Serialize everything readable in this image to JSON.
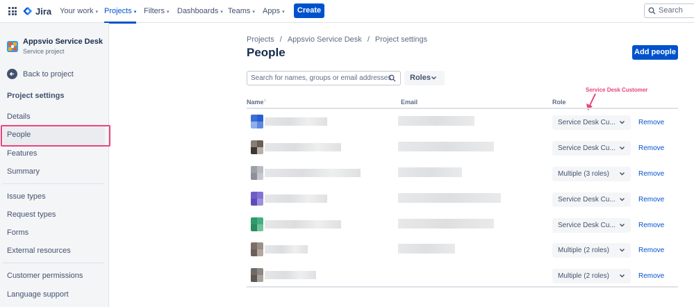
{
  "nav": {
    "logo_text": "Jira",
    "items": [
      {
        "label": "Your work",
        "active": false
      },
      {
        "label": "Projects",
        "active": true
      },
      {
        "label": "Filters",
        "active": false
      },
      {
        "label": "Dashboards",
        "active": false
      },
      {
        "label": "Teams",
        "active": false
      },
      {
        "label": "Apps",
        "active": false
      }
    ],
    "create_label": "Create",
    "search_placeholder": "Search"
  },
  "sidebar": {
    "project_name": "Appsvio Service Desk",
    "project_type": "Service project",
    "back_label": "Back to project",
    "heading": "Project settings",
    "items": [
      {
        "label": "Details"
      },
      {
        "label": "People"
      },
      {
        "label": "Features"
      },
      {
        "label": "Summary"
      },
      {
        "label": "Issue types"
      },
      {
        "label": "Request types"
      },
      {
        "label": "Forms"
      },
      {
        "label": "External resources"
      },
      {
        "label": "Customer permissions"
      },
      {
        "label": "Language support"
      }
    ]
  },
  "main": {
    "breadcrumb": [
      "Projects",
      "/",
      "Appsvio Service Desk",
      "/",
      "Project settings"
    ],
    "title": "People",
    "add_label": "Add people",
    "filter_placeholder": "Search for names, groups or email addresses",
    "roles_label": "Roles",
    "annotation": "Service Desk Customer",
    "columns": {
      "name": "Name",
      "sort_indicator": "↑",
      "email": "Email",
      "role": "Role"
    },
    "rows": [
      {
        "role": "Service Desk Cu...",
        "remove": "Remove",
        "avatar": [
          "#3a6fd8",
          "#2b5fd1",
          "#8fb0ea",
          "#5f89df"
        ]
      },
      {
        "role": "Service Desk Cu...",
        "remove": "Remove",
        "avatar": [
          "#8a7d72",
          "#6b5e55",
          "#3b3733",
          "#b8aea4"
        ]
      },
      {
        "role": "Multiple (3 roles)",
        "remove": "Remove",
        "avatar": [
          "#9ea0a8",
          "#b9bbc2",
          "#8e9098",
          "#c8c9ce"
        ]
      },
      {
        "role": "Service Desk Cu...",
        "remove": "Remove",
        "avatar": [
          "#6e5ec8",
          "#8273d4",
          "#5b4cb8",
          "#9c90de"
        ]
      },
      {
        "role": "Service Desk Cu...",
        "remove": "Remove",
        "avatar": [
          "#2e9a6b",
          "#45b07f",
          "#2a8a60",
          "#6fc39b"
        ]
      },
      {
        "role": "Multiple (2 roles)",
        "remove": "Remove",
        "avatar": [
          "#7d6f66",
          "#9c8f86",
          "#6b5f57",
          "#b3a79f"
        ]
      },
      {
        "role": "Multiple (2 roles)",
        "remove": "Remove",
        "avatar": [
          "#6f6a66",
          "#8e8883",
          "#5c5854",
          "#a9a39e"
        ]
      }
    ]
  },
  "colors": {
    "accent": "#0052cc",
    "annotation": "#e8447a"
  }
}
